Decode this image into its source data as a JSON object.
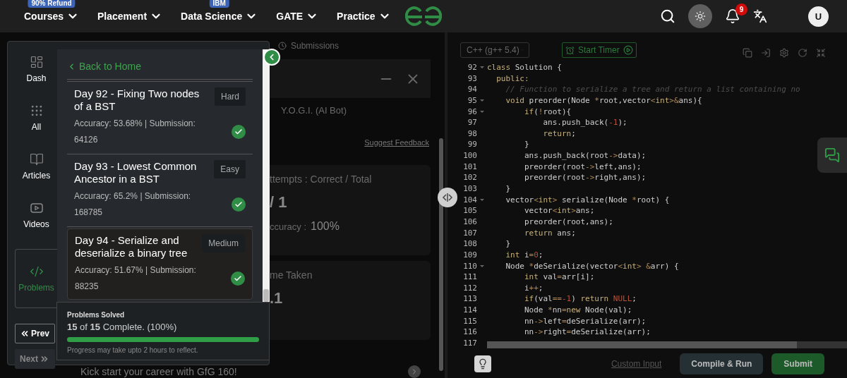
{
  "nav": {
    "items": [
      {
        "label": "Courses",
        "badge": "90% Refund"
      },
      {
        "label": "Placement"
      },
      {
        "label": "Data Science",
        "badge": "IBM"
      },
      {
        "label": "GATE"
      },
      {
        "label": "Practice"
      }
    ],
    "notifications": "9",
    "avatar": "U"
  },
  "sidebar": {
    "items": [
      {
        "label": "Dash",
        "selected": false
      },
      {
        "label": "All",
        "selected": false
      },
      {
        "label": "Articles",
        "selected": false
      },
      {
        "label": "Videos",
        "selected": false
      },
      {
        "label": "Problems",
        "selected": true
      }
    ],
    "prev": {
      "label": "Prev",
      "disabled": false
    },
    "next": {
      "label": "Next",
      "disabled": true
    }
  },
  "problem_list": {
    "back": "Back to Home",
    "problems": [
      {
        "title": "Day 92 - Fixing Two nodes of a BST",
        "difficulty": "Hard",
        "stats": "Accuracy: 53.68% | Submission: 64126",
        "solved": true,
        "selected": false
      },
      {
        "title": "Day 93 - Lowest Common Ancestor in a BST",
        "difficulty": "Easy",
        "stats": "Accuracy: 65.2% | Submission: 168785",
        "solved": true,
        "selected": false
      },
      {
        "title": "Day 94 - Serialize and deserialize a binary tree",
        "difficulty": "Medium",
        "stats": "Accuracy: 51.67% | Submission: 88235",
        "solved": true,
        "selected": true
      }
    ]
  },
  "progress": {
    "title": "Problems Solved",
    "summary": "**15** of **15** Complete. (100%)",
    "level": 1,
    "note": "Progress may take upto 2 hours to reflect."
  },
  "left_pane": {
    "tab": "Submissions",
    "chat_title": "Y.O.G.I. (AI Bot)",
    "feedback_link": "Suggest Feedback",
    "stats": [
      {
        "label": "ttempts : Correct / Total",
        "value": "/ 1",
        "sublabel": "ccuracy :",
        "subvalue": "100%"
      },
      {
        "label": "me Taken",
        "value": ".1"
      }
    ],
    "promo": "Kick start your career with GfG 160!"
  },
  "editor": {
    "language": "C++ (g++ 5.4)",
    "timer": "Start Timer",
    "custom_input": "Custom Input",
    "compile": "Compile & Run",
    "submit": "Submit",
    "lines": [
      {
        "number": "92",
        "foldable": true,
        "tokens": [
          {
            "kind": "k",
            "text": "class"
          },
          {
            "kind": "t",
            "text": " Solution {"
          }
        ]
      },
      {
        "number": "93",
        "foldable": false,
        "tokens": [
          {
            "kind": "k",
            "text": "  public:"
          }
        ]
      },
      {
        "number": "94",
        "foldable": false,
        "tokens": [
          {
            "kind": "c",
            "text": "    // Function to serialize a tree and return a list containing no"
          }
        ]
      },
      {
        "number": "95",
        "foldable": true,
        "tokens": [
          {
            "kind": "k",
            "text": "    void"
          },
          {
            "kind": "t",
            "text": " preorder(Node "
          },
          {
            "kind": "o",
            "text": "*"
          },
          {
            "kind": "t",
            "text": "root,vector"
          },
          {
            "kind": "o",
            "text": "<"
          },
          {
            "kind": "k",
            "text": "int"
          },
          {
            "kind": "o",
            "text": ">&"
          },
          {
            "kind": "t",
            "text": "ans){"
          }
        ]
      },
      {
        "number": "96",
        "foldable": true,
        "tokens": [
          {
            "kind": "k",
            "text": "        if"
          },
          {
            "kind": "t",
            "text": "("
          },
          {
            "kind": "o",
            "text": "!"
          },
          {
            "kind": "t",
            "text": "root){"
          }
        ]
      },
      {
        "number": "97",
        "foldable": false,
        "tokens": [
          {
            "kind": "t",
            "text": "            ans.push_back("
          },
          {
            "kind": "n",
            "text": "-1"
          },
          {
            "kind": "t",
            "text": ");"
          }
        ]
      },
      {
        "number": "98",
        "foldable": false,
        "tokens": [
          {
            "kind": "k",
            "text": "            return"
          },
          {
            "kind": "t",
            "text": ";"
          }
        ]
      },
      {
        "number": "99",
        "foldable": false,
        "tokens": [
          {
            "kind": "t",
            "text": "        }"
          }
        ]
      },
      {
        "number": "100",
        "foldable": false,
        "tokens": [
          {
            "kind": "t",
            "text": "        ans.push_back(root"
          },
          {
            "kind": "o",
            "text": "->"
          },
          {
            "kind": "t",
            "text": "data);"
          }
        ]
      },
      {
        "number": "101",
        "foldable": false,
        "tokens": [
          {
            "kind": "t",
            "text": "        preorder(root"
          },
          {
            "kind": "o",
            "text": "->"
          },
          {
            "kind": "t",
            "text": "left,ans);"
          }
        ]
      },
      {
        "number": "102",
        "foldable": false,
        "tokens": [
          {
            "kind": "t",
            "text": "        preorder(root"
          },
          {
            "kind": "o",
            "text": "->"
          },
          {
            "kind": "t",
            "text": "right,ans);"
          }
        ]
      },
      {
        "number": "103",
        "foldable": false,
        "tokens": [
          {
            "kind": "t",
            "text": "    }"
          }
        ]
      },
      {
        "number": "104",
        "foldable": true,
        "tokens": [
          {
            "kind": "t",
            "text": "    vector"
          },
          {
            "kind": "o",
            "text": "<"
          },
          {
            "kind": "k",
            "text": "int"
          },
          {
            "kind": "o",
            "text": ">"
          },
          {
            "kind": "t",
            "text": " serialize(Node "
          },
          {
            "kind": "o",
            "text": "*"
          },
          {
            "kind": "t",
            "text": "root) {"
          }
        ]
      },
      {
        "number": "105",
        "foldable": false,
        "tokens": [
          {
            "kind": "t",
            "text": "        vector"
          },
          {
            "kind": "o",
            "text": "<"
          },
          {
            "kind": "k",
            "text": "int"
          },
          {
            "kind": "o",
            "text": ">"
          },
          {
            "kind": "t",
            "text": "ans;"
          }
        ]
      },
      {
        "number": "106",
        "foldable": false,
        "tokens": [
          {
            "kind": "t",
            "text": "        preorder(root,ans);"
          }
        ]
      },
      {
        "number": "107",
        "foldable": false,
        "tokens": [
          {
            "kind": "k",
            "text": "        return"
          },
          {
            "kind": "t",
            "text": " ans;"
          }
        ]
      },
      {
        "number": "108",
        "foldable": false,
        "tokens": [
          {
            "kind": "t",
            "text": "    }"
          }
        ]
      },
      {
        "number": "109",
        "foldable": false,
        "tokens": [
          {
            "kind": "k",
            "text": "    int"
          },
          {
            "kind": "t",
            "text": " i"
          },
          {
            "kind": "o",
            "text": "="
          },
          {
            "kind": "n",
            "text": "0"
          },
          {
            "kind": "t",
            "text": ";"
          }
        ]
      },
      {
        "number": "110",
        "foldable": true,
        "tokens": [
          {
            "kind": "t",
            "text": "    Node "
          },
          {
            "kind": "o",
            "text": "*"
          },
          {
            "kind": "t",
            "text": "deSerialize(vector"
          },
          {
            "kind": "o",
            "text": "<"
          },
          {
            "kind": "k",
            "text": "int"
          },
          {
            "kind": "o",
            "text": "> &"
          },
          {
            "kind": "t",
            "text": "arr) {"
          }
        ]
      },
      {
        "number": "111",
        "foldable": false,
        "tokens": [
          {
            "kind": "k",
            "text": "        int"
          },
          {
            "kind": "t",
            "text": " val"
          },
          {
            "kind": "o",
            "text": "="
          },
          {
            "kind": "t",
            "text": "arr[i];"
          }
        ]
      },
      {
        "number": "112",
        "foldable": false,
        "tokens": [
          {
            "kind": "t",
            "text": "        i"
          },
          {
            "kind": "o",
            "text": "++"
          },
          {
            "kind": "t",
            "text": ";"
          }
        ]
      },
      {
        "number": "113",
        "foldable": false,
        "tokens": [
          {
            "kind": "k",
            "text": "        if"
          },
          {
            "kind": "t",
            "text": "(val"
          },
          {
            "kind": "o",
            "text": "=="
          },
          {
            "kind": "n",
            "text": "-1"
          },
          {
            "kind": "t",
            "text": ") "
          },
          {
            "kind": "k",
            "text": "return"
          },
          {
            "kind": "n",
            "text": " NULL"
          },
          {
            "kind": "t",
            "text": ";"
          }
        ]
      },
      {
        "number": "114",
        "foldable": false,
        "tokens": [
          {
            "kind": "t",
            "text": "        Node "
          },
          {
            "kind": "o",
            "text": "*"
          },
          {
            "kind": "t",
            "text": "nn"
          },
          {
            "kind": "o",
            "text": "="
          },
          {
            "kind": "k",
            "text": "new"
          },
          {
            "kind": "t",
            "text": " Node(val);"
          }
        ]
      },
      {
        "number": "115",
        "foldable": false,
        "tokens": [
          {
            "kind": "t",
            "text": "        nn"
          },
          {
            "kind": "o",
            "text": "->"
          },
          {
            "kind": "t",
            "text": "left"
          },
          {
            "kind": "o",
            "text": "="
          },
          {
            "kind": "t",
            "text": "deSerialize(arr);"
          }
        ]
      },
      {
        "number": "116",
        "foldable": false,
        "tokens": [
          {
            "kind": "t",
            "text": "        nn"
          },
          {
            "kind": "o",
            "text": "->"
          },
          {
            "kind": "t",
            "text": "right"
          },
          {
            "kind": "o",
            "text": "="
          },
          {
            "kind": "t",
            "text": "deSerialize(arr);"
          }
        ]
      },
      {
        "number": "117",
        "foldable": false
      }
    ]
  }
}
